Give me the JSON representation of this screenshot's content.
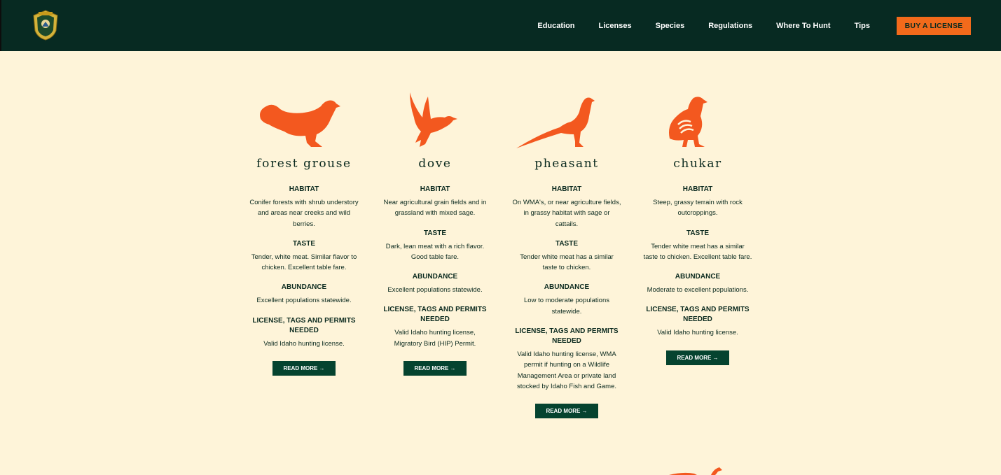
{
  "header": {
    "logo_icon": "idaho-fish-and-game-seal-icon",
    "nav": [
      "Education",
      "Licenses",
      "Species",
      "Regulations",
      "Where To Hunt",
      "Tips"
    ],
    "buy_label": "BUY A LICENSE"
  },
  "colors": {
    "header_bg": "#072a22",
    "page_bg": "#fef4d9",
    "accent_orange": "#f26a1b",
    "bird_orange": "#f3581f",
    "button_green": "#05432f"
  },
  "species": [
    {
      "name": "forest grouse",
      "icon": "grouse-icon",
      "habitat_h": "HABITAT",
      "habitat": "Conifer forests with shrub understory and areas near creeks and wild berries.",
      "taste_h": "TASTE",
      "taste": "Tender, white meat. Similar flavor to chicken. Excellent table fare.",
      "abundance_h": "ABUNDANCE",
      "abundance": "Excellent populations statewide.",
      "license_h": "LICENSE, TAGS AND PERMITS NEEDED",
      "license": "Valid Idaho hunting license.",
      "read_more": "READ MORE →"
    },
    {
      "name": "dove",
      "icon": "dove-icon",
      "habitat_h": "HABITAT",
      "habitat": "Near agricultural grain fields and in grassland with mixed sage.",
      "taste_h": "TASTE",
      "taste": "Dark, lean meat with a rich flavor. Good table fare.",
      "abundance_h": "ABUNDANCE",
      "abundance": "Excellent populations statewide.",
      "license_h": "LICENSE, TAGS AND PERMITS NEEDED",
      "license": "Valid Idaho hunting license, Migratory Bird (HIP) Permit.",
      "read_more": "READ MORE →"
    },
    {
      "name": "pheasant",
      "icon": "pheasant-icon",
      "habitat_h": "HABITAT",
      "habitat": "On WMA's, or near agriculture fields, in grassy habitat with sage or cattails.",
      "taste_h": "TASTE",
      "taste": "Tender white meat has a similar taste to chicken.",
      "abundance_h": "ABUNDANCE",
      "abundance": "Low to moderate populations statewide.",
      "license_h": "LICENSE, TAGS AND PERMITS NEEDED",
      "license": "Valid Idaho hunting license, WMA permit if hunting on a Wildlife Management Area or private land stocked by Idaho Fish and Game.",
      "read_more": "READ MORE →"
    },
    {
      "name": "chukar",
      "icon": "chukar-icon",
      "habitat_h": "HABITAT",
      "habitat": "Steep, grassy terrain with rock outcroppings.",
      "taste_h": "TASTE",
      "taste": "Tender white meat has a similar taste to chicken. Excellent table fare.",
      "abundance_h": "ABUNDANCE",
      "abundance": "Moderate to excellent populations.",
      "license_h": "LICENSE, TAGS AND PERMITS NEEDED",
      "license": "Valid Idaho hunting license.",
      "read_more": "READ MORE →"
    }
  ]
}
